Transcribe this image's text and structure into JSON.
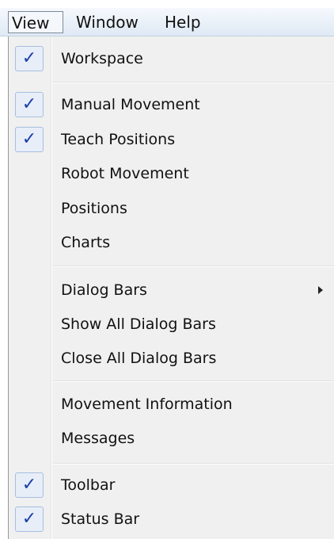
{
  "menubar": {
    "items": [
      {
        "label": "View"
      },
      {
        "label": "Window"
      },
      {
        "label": "Help"
      }
    ]
  },
  "view_menu": {
    "check_glyph": "✓",
    "items": [
      {
        "label": "Workspace",
        "checked": true
      },
      {
        "label": "Manual Movement",
        "checked": true
      },
      {
        "label": "Teach Positions",
        "checked": true
      },
      {
        "label": "Robot Movement",
        "checked": false
      },
      {
        "label": "Positions",
        "checked": false
      },
      {
        "label": "Charts",
        "checked": false
      },
      {
        "label": "Dialog Bars",
        "checked": false,
        "submenu": true
      },
      {
        "label": "Show All Dialog Bars",
        "checked": false
      },
      {
        "label": "Close All Dialog Bars",
        "checked": false
      },
      {
        "label": "Movement Information",
        "checked": false
      },
      {
        "label": "Messages",
        "checked": false
      },
      {
        "label": "Toolbar",
        "checked": true
      },
      {
        "label": "Status Bar",
        "checked": true
      }
    ]
  },
  "colors": {
    "check": "#1b3fa8",
    "menu_bg": "#f0f0f0"
  }
}
